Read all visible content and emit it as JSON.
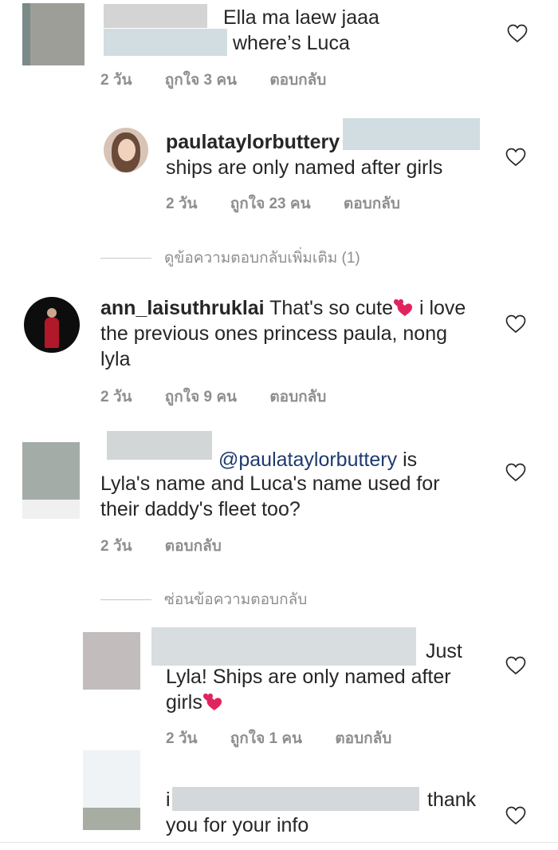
{
  "comments": [
    {
      "text_line1": "Ella ma laew jaaa",
      "text_line2": "where’s Luca",
      "time": "2 วัน",
      "likes": "ถูกใจ 3 คน",
      "reply": "ตอบกลับ"
    },
    {
      "username": "paulataylorbuttery",
      "text": "ships are only named after girls",
      "time": "2 วัน",
      "likes": "ถูกใจ 23 คน",
      "reply": "ตอบกลับ"
    },
    {
      "username": "ann_laisuthruklai",
      "text_a": "That's so cute",
      "text_b": "i love",
      "text_line2": "the previous ones princess paula, nong",
      "text_line3": "lyla",
      "time": "2 วัน",
      "likes": "ถูกใจ 9 คน",
      "reply": "ตอบกลับ"
    },
    {
      "mention": "@paulataylorbuttery",
      "text_a": "is",
      "text_line2": "Lyla's name and Luca's name used for",
      "text_line3": "their daddy's fleet too?",
      "time": "2 วัน",
      "reply": "ตอบกลับ"
    },
    {
      "text_a": "Just",
      "text_line2": "Lyla! Ships are only named after",
      "text_line3": "girls",
      "time": "2 วัน",
      "likes": "ถูกใจ 1 คน",
      "reply": "ตอบกลับ"
    },
    {
      "text_a": "thank",
      "text_line2": "you for your info"
    }
  ],
  "view_more_replies": "ดูข้อความตอบกลับเพิ่มเติม (1)",
  "hide_replies": "ซ่อนข้อความตอบกลับ",
  "colors": {
    "text": "#262626",
    "meta": "#8e8e8e",
    "mention": "#1e3a6e",
    "heart_emoji": "#e0245e"
  }
}
